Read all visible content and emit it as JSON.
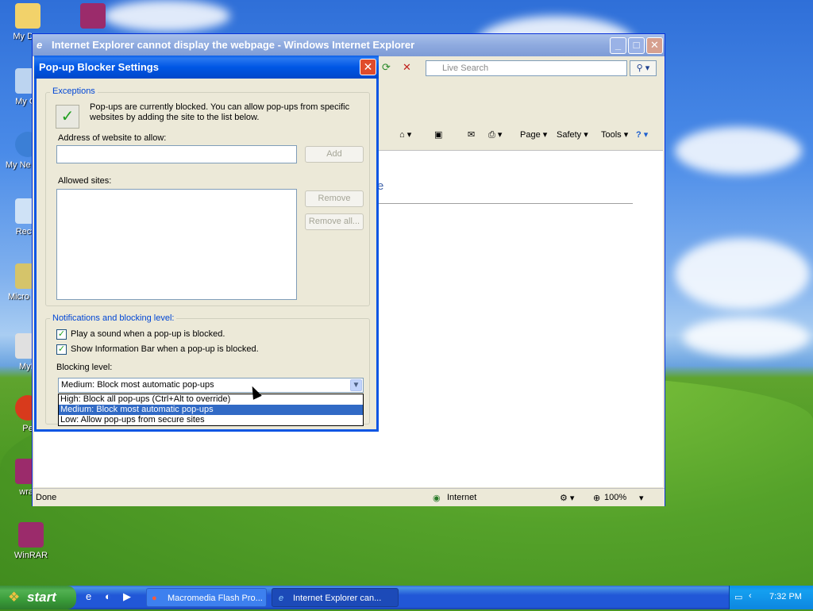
{
  "desktop": {
    "icons": [
      {
        "label": "My Doc"
      },
      {
        "label": ""
      },
      {
        "label": "My Co"
      },
      {
        "label": "My Ne Plac"
      },
      {
        "label": "Recyc"
      },
      {
        "label": "Micro Outl"
      },
      {
        "label": "MyP"
      },
      {
        "label": "Pe"
      },
      {
        "label": "wrar"
      },
      {
        "label": "WinRAR"
      }
    ]
  },
  "ie": {
    "title": "Internet Explorer cannot display the webpage - Windows Internet Explorer",
    "search_placeholder": "Live Search",
    "commands": {
      "page": "Page",
      "safety": "Safety",
      "tools": "Tools"
    },
    "status": {
      "left": "Done",
      "zone": "Internet",
      "zoom": "100%"
    },
    "content_fragment": "e"
  },
  "dialog": {
    "title": "Pop-up Blocker Settings",
    "exceptions": {
      "group_label": "Exceptions",
      "description": "Pop-ups are currently blocked.  You can allow pop-ups from specific websites by adding the site to the list below.",
      "address_label": "Address of website to allow:",
      "address_value": "",
      "add_button": "Add",
      "allowed_sites_label": "Allowed sites:",
      "remove_button": "Remove",
      "remove_all_button": "Remove all..."
    },
    "notifications": {
      "group_label": "Notifications and blocking level:",
      "play_sound": {
        "label": "Play a sound when a pop-up is blocked.",
        "checked": true
      },
      "show_infobar": {
        "label": "Show Information Bar when a pop-up is blocked.",
        "checked": true
      },
      "blocking_level_label": "Blocking level:",
      "blocking_level_value": "Medium: Block most automatic pop-ups",
      "options": [
        "High: Block all pop-ups (Ctrl+Alt to override)",
        "Medium: Block most automatic pop-ups",
        "Low: Allow pop-ups from secure sites"
      ],
      "selected_index": 1
    }
  },
  "taskbar": {
    "start_label": "start",
    "tasks": [
      {
        "label": "Macromedia Flash Pro..."
      },
      {
        "label": "Internet Explorer can..."
      }
    ],
    "clock": "7:32 PM"
  },
  "colors": {
    "xp_blue": "#0a55e3",
    "selection": "#316ac5",
    "group_label": "#0046d5"
  }
}
